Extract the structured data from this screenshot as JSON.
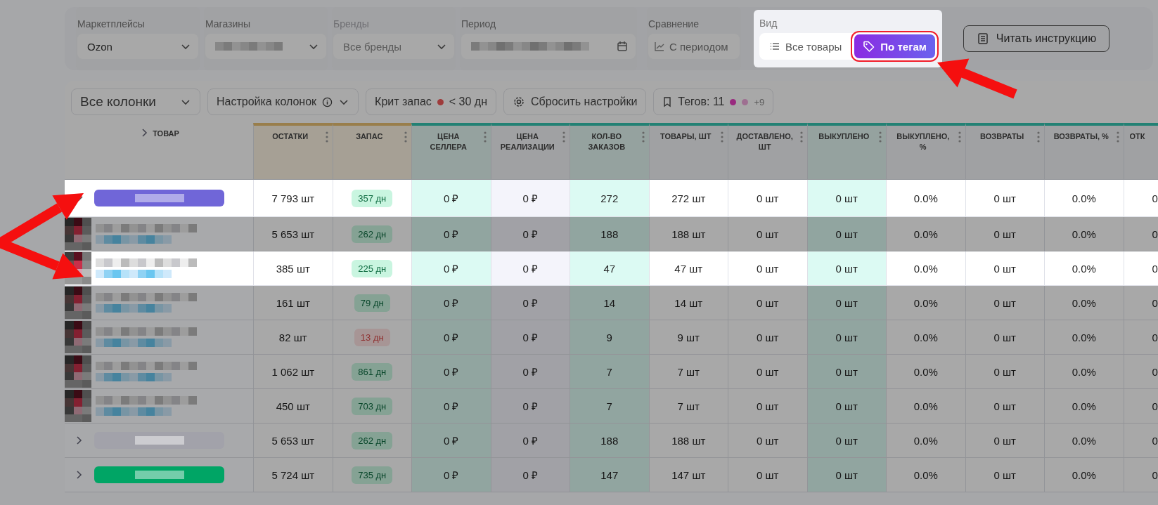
{
  "filters": {
    "groups": [
      {
        "kind": "select",
        "label": "Маркетплейсы",
        "value": "Ozon",
        "disabled": false,
        "highlighted": false
      },
      {
        "kind": "blurred-select",
        "label": "Магазины",
        "disabled": false,
        "highlighted": false
      },
      {
        "kind": "select",
        "label": "Бренды",
        "value": "Все бренды",
        "disabled": true,
        "highlighted": false
      },
      {
        "kind": "date",
        "label": "Период",
        "disabled": false,
        "highlighted": false
      },
      {
        "kind": "compare",
        "label": "Сравнение",
        "value": "С периодом",
        "disabled": false,
        "highlighted": false
      },
      {
        "kind": "view",
        "label": "Вид",
        "disabled": false,
        "highlighted": true,
        "options": [
          {
            "label": "Все товары",
            "selected": false,
            "outlined": false
          },
          {
            "label": "По тегам",
            "selected": true,
            "outlined": true
          }
        ]
      }
    ],
    "help_button": {
      "label": "Читать инструкцию",
      "highlighted": false
    }
  },
  "toolbar": {
    "highlighted": false,
    "columns_select": "Все колонки",
    "column_settings": "Настройка колонок",
    "crit_label": "Крит запас",
    "crit_value": "< 30 дн",
    "reset": "Сбросить настройки",
    "tags": "Тегов: 11",
    "tags_more": "+9"
  },
  "table": {
    "header_highlighted": false,
    "product_header": "ТОВАР",
    "columns": [
      "ОСТАТКИ",
      "ЗАПАС",
      "ЦЕНА СЕЛЛЕРА",
      "ЦЕНА РЕАЛИЗАЦИИ",
      "КОЛ-ВО ЗАКАЗОВ",
      "ТОВАРЫ, ШТ",
      "ДОСТАВЛЕНО, ШТ",
      "ВЫКУПЛЕНО",
      "ВЫКУПЛЕНО, %",
      "ВОЗВРАТЫ",
      "ВОЗВРАТЫ, %",
      "ОТК"
    ],
    "rows": [
      {
        "kind": "tag",
        "color": "#7066d8",
        "expanded": true,
        "highlighted": true,
        "critical": false,
        "cells": [
          "7 793 шт",
          "357 дн",
          "0 ₽",
          "0 ₽",
          "272",
          "272 шт",
          "0 шт",
          "0 шт",
          "0.0%",
          "0 шт",
          "0.0%",
          "0"
        ],
        "children": [
          {
            "kind": "product",
            "highlighted": false,
            "critical": false,
            "cells": [
              "5 653 шт",
              "262 дн",
              "0 ₽",
              "0 ₽",
              "188",
              "188 шт",
              "0 шт",
              "0 шт",
              "0.0%",
              "0 шт",
              "0.0%",
              "0"
            ]
          },
          {
            "kind": "product",
            "highlighted": true,
            "critical": false,
            "cells": [
              "385 шт",
              "225 дн",
              "0 ₽",
              "0 ₽",
              "47",
              "47 шт",
              "0 шт",
              "0 шт",
              "0.0%",
              "0 шт",
              "0.0%",
              "0"
            ]
          },
          {
            "kind": "product",
            "highlighted": false,
            "critical": false,
            "cells": [
              "161 шт",
              "79 дн",
              "0 ₽",
              "0 ₽",
              "14",
              "14 шт",
              "0 шт",
              "0 шт",
              "0.0%",
              "0 шт",
              "0.0%",
              "0"
            ]
          },
          {
            "kind": "product",
            "highlighted": false,
            "critical": true,
            "cells": [
              "82 шт",
              "13 дн",
              "0 ₽",
              "0 ₽",
              "9",
              "9 шт",
              "0 шт",
              "0 шт",
              "0.0%",
              "0 шт",
              "0.0%",
              "0"
            ]
          },
          {
            "kind": "product",
            "highlighted": false,
            "critical": false,
            "cells": [
              "1 062 шт",
              "861 дн",
              "0 ₽",
              "0 ₽",
              "7",
              "7 шт",
              "0 шт",
              "0 шт",
              "0.0%",
              "0 шт",
              "0.0%",
              "0"
            ]
          },
          {
            "kind": "product",
            "highlighted": false,
            "critical": false,
            "cells": [
              "450 шт",
              "703 дн",
              "0 ₽",
              "0 ₽",
              "7",
              "7 шт",
              "0 шт",
              "0 шт",
              "0.0%",
              "0 шт",
              "0.0%",
              "0"
            ]
          }
        ]
      },
      {
        "kind": "tag",
        "color": "#a2a2aa",
        "expanded": false,
        "highlighted": false,
        "critical": false,
        "cells": [
          "5 653 шт",
          "262 дн",
          "0 ₽",
          "0 ₽",
          "188",
          "188 шт",
          "0 шт",
          "0 шт",
          "0.0%",
          "0 шт",
          "0.0%",
          "0"
        ]
      },
      {
        "kind": "tag",
        "color": "#00a565",
        "expanded": false,
        "highlighted": false,
        "critical": false,
        "cells": [
          "5 724 шт",
          "735 дн",
          "0 ₽",
          "0 ₽",
          "147",
          "147 шт",
          "0 шт",
          "0 шт",
          "0.0%",
          "0 шт",
          "0.0%",
          "0"
        ]
      }
    ]
  }
}
